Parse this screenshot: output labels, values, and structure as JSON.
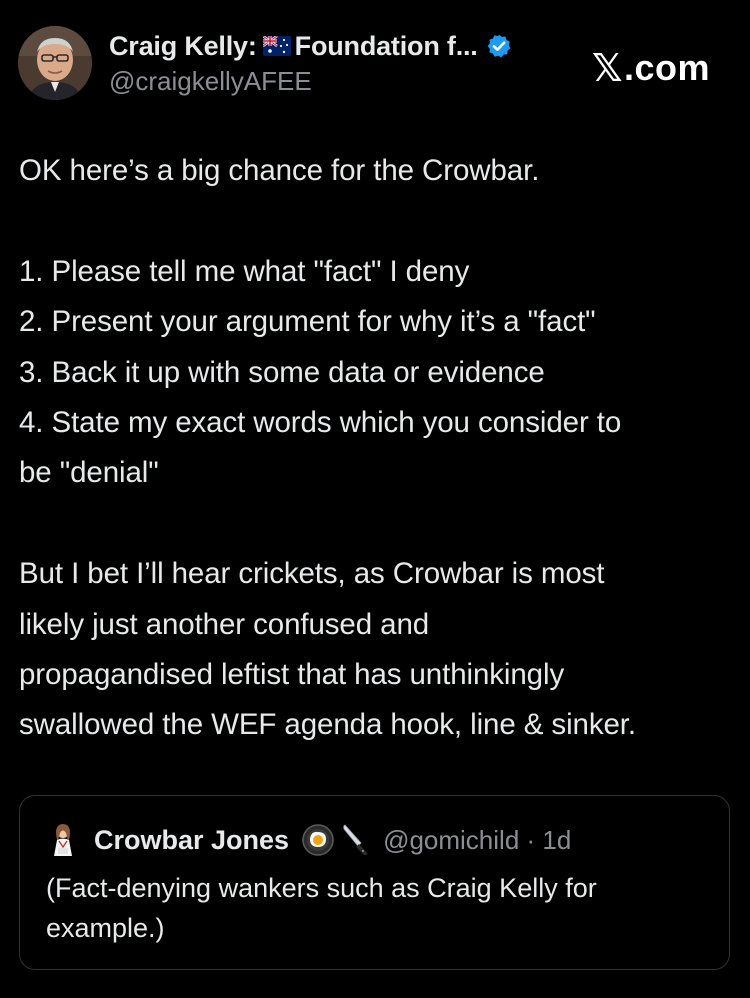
{
  "author": {
    "display_name_part1": "Craig Kelly:",
    "display_name_part2": "Foundation f...",
    "handle": "@craigkellyAFEE",
    "flag_icon": "australia-flag-icon",
    "verified_icon": "verified-badge-icon",
    "verified_color": "#1d9bf0"
  },
  "brand": {
    "x": "𝕏",
    "suffix": ".com"
  },
  "tweet": {
    "line1": "OK here’s a big chance for the Crowbar.",
    "item1": "1. Please tell me what \"fact\" I deny",
    "item2": "2. Present your argument for why it’s a \"fact\"",
    "item3": "3. Back it up with some data or evidence",
    "item4a": "4. State my exact words which you consider to",
    "item4b": "be \"denial\"",
    "para2_line1": "But I bet I’ll hear crickets, as Crowbar is most",
    "para2_line2": "likely just another confused and",
    "para2_line3": "propagandised leftist that has unthinkingly",
    "para2_line4": "swallowed the WEF agenda hook, line & sinker."
  },
  "quote": {
    "name": "Crowbar Jones",
    "handle": "@gomichild · 1d",
    "emoji1": "frying-pan-egg-icon",
    "emoji2": "kitchen-knife-icon",
    "text_line1": "(Fact-denying wankers such as Craig Kelly for",
    "text_line2": "example.)"
  },
  "colors": {
    "background": "#000000",
    "text": "#e7e9ea",
    "secondary_text": "#8b8f94",
    "border": "#2f3336"
  }
}
